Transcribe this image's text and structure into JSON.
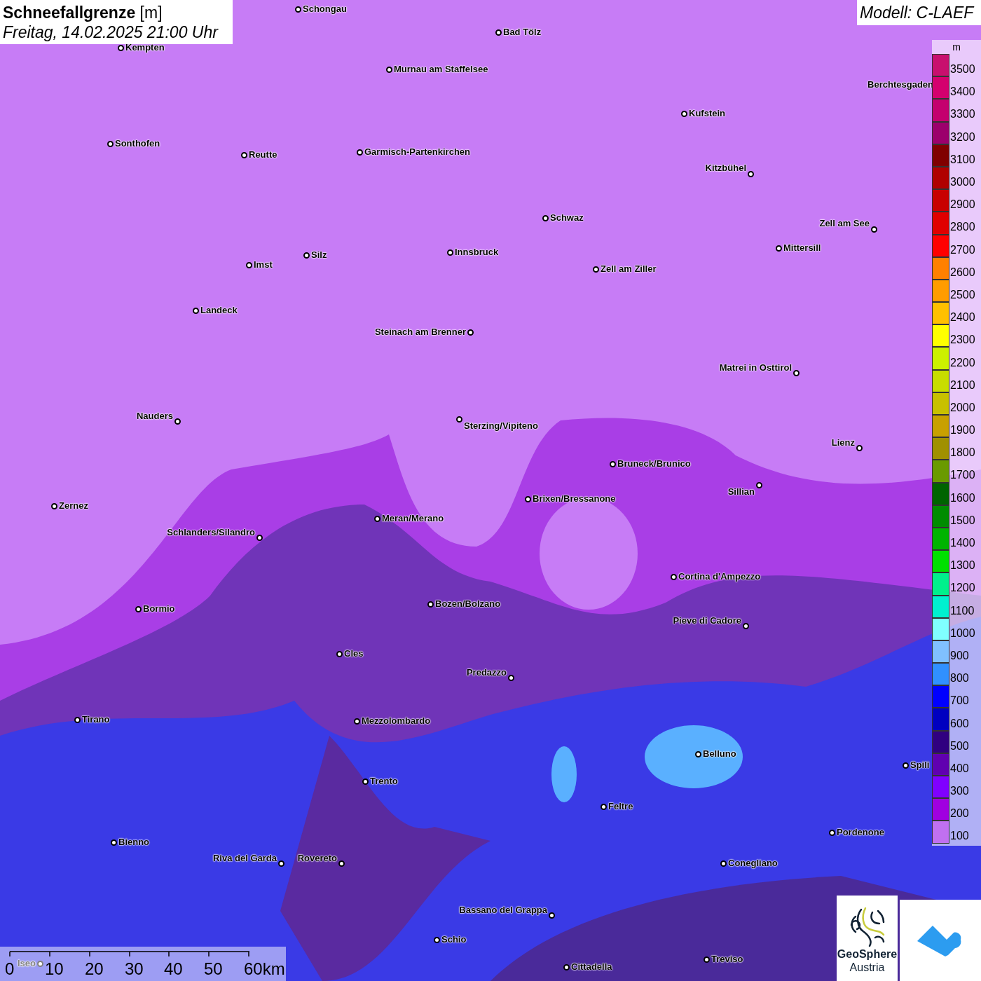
{
  "title": "**Schneefallgrenze** [m]",
  "subtitle": "Freitag, 14.02.2025 21:00 Uhr",
  "model": "Modell: C-LAEF",
  "cities": [
    "Schongau",
    "Bad Tölz",
    "Kempten",
    "Murnau am Staffelsee",
    "Berchtesgaden",
    "Kufstein",
    "Sonthofen",
    "Reutte",
    "Garmisch-Partenkirchen",
    "Kitzbühel",
    "Schwaz",
    "Zell am See",
    "Mittersill",
    "Innsbruck",
    "Silz",
    "Imst",
    "Zell am Ziller",
    "Landeck",
    "Steinach am Brenner",
    "Matrei in Osttirol",
    "Nauders",
    "Sterzing/Vipiteno",
    "Lienz",
    "Bruneck/Brunico",
    "Sillian",
    "Brixen/Bressanone",
    "Zernez",
    "Meran/Merano",
    "Schlanders/Silandro",
    "Cortina d'Ampezzo",
    "Bozen/Bolzano",
    "Bormio",
    "Pieve di Cadore",
    "Cles",
    "Predazzo",
    "Tirano",
    "Mezzolombardo",
    "Belluno",
    "Spili",
    "Trento",
    "Feltre",
    "Pordenone",
    "Bienno",
    "Riva del Garda",
    "Rovereto",
    "Conegliano",
    "Bassano del Grappa",
    "Schio",
    "Treviso",
    "Cittadella",
    "Iseo"
  ],
  "legend": {
    "unit": "m",
    "items": [
      {
        "label": "3500",
        "color": "#c8106e"
      },
      {
        "label": "3400",
        "color": "#d4006e"
      },
      {
        "label": "3300",
        "color": "#c4006e"
      },
      {
        "label": "3200",
        "color": "#9c006c"
      },
      {
        "label": "3100",
        "color": "#800000"
      },
      {
        "label": "3000",
        "color": "#b00000"
      },
      {
        "label": "2900",
        "color": "#c80000"
      },
      {
        "label": "2800",
        "color": "#e00000"
      },
      {
        "label": "2700",
        "color": "#ff0000"
      },
      {
        "label": "2600",
        "color": "#ff8000"
      },
      {
        "label": "2500",
        "color": "#ff9c00"
      },
      {
        "label": "2400",
        "color": "#ffc000"
      },
      {
        "label": "2300",
        "color": "#ffff00"
      },
      {
        "label": "2200",
        "color": "#ccf000"
      },
      {
        "label": "2100",
        "color": "#c8dc00"
      },
      {
        "label": "2000",
        "color": "#c8c000"
      },
      {
        "label": "1900",
        "color": "#c8a000"
      },
      {
        "label": "1800",
        "color": "#a09000"
      },
      {
        "label": "1700",
        "color": "#6a9a00"
      },
      {
        "label": "1600",
        "color": "#006400"
      },
      {
        "label": "1500",
        "color": "#008c00"
      },
      {
        "label": "1400",
        "color": "#00b400"
      },
      {
        "label": "1300",
        "color": "#00e000"
      },
      {
        "label": "1200",
        "color": "#00f08c"
      },
      {
        "label": "1100",
        "color": "#00f0d0"
      },
      {
        "label": "1000",
        "color": "#80ffff"
      },
      {
        "label": "900",
        "color": "#80c0ff"
      },
      {
        "label": "800",
        "color": "#3090ff"
      },
      {
        "label": "700",
        "color": "#0000ff"
      },
      {
        "label": "600",
        "color": "#0000c0"
      },
      {
        "label": "500",
        "color": "#300080"
      },
      {
        "label": "400",
        "color": "#6000b0"
      },
      {
        "label": "300",
        "color": "#8000ff"
      },
      {
        "label": "200",
        "color": "#a000e0"
      },
      {
        "label": "100",
        "color": "#c070f0"
      }
    ]
  },
  "scale_bar": {
    "labels": [
      "0",
      "10",
      "20",
      "30",
      "40",
      "50",
      "60km"
    ]
  },
  "logos": [
    {
      "kind": "geosphere",
      "lines": [
        "GeoSphere",
        "Austria"
      ]
    },
    {
      "kind": "cloud"
    }
  ]
}
